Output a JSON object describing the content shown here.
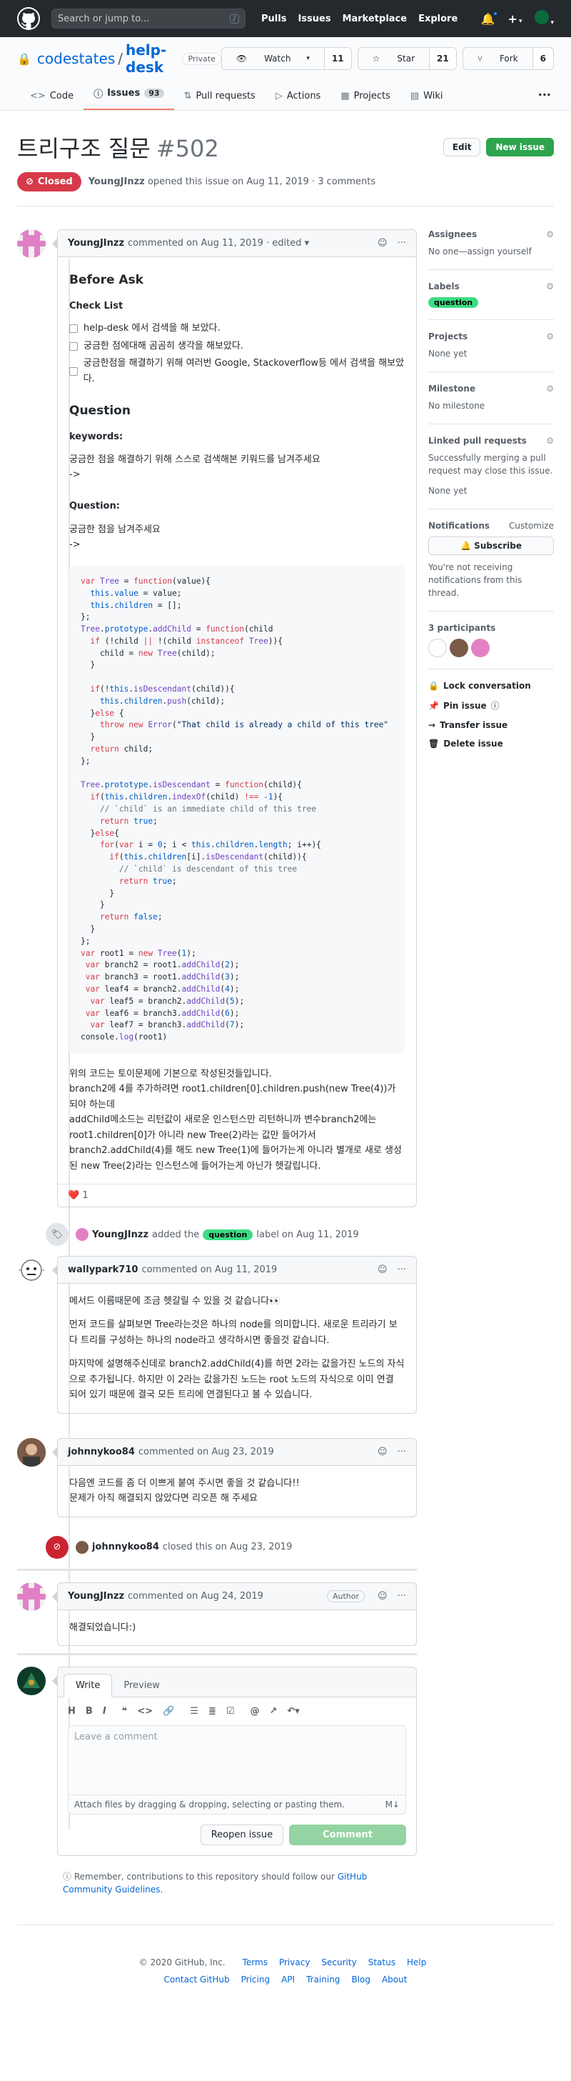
{
  "topbar": {
    "search_placeholder": "Search or jump to...",
    "slash": "/",
    "nav": [
      "Pulls",
      "Issues",
      "Marketplace",
      "Explore"
    ]
  },
  "repo": {
    "owner": "codestates",
    "sep": "/",
    "name": "help-desk",
    "visibility": "Private",
    "watch": "Watch",
    "watch_count": "11",
    "star": "Star",
    "star_count": "21",
    "fork": "Fork",
    "fork_count": "6"
  },
  "tabs": [
    {
      "label": "Code"
    },
    {
      "label": "Issues",
      "count": "93"
    },
    {
      "label": "Pull requests"
    },
    {
      "label": "Actions"
    },
    {
      "label": "Projects"
    },
    {
      "label": "Wiki"
    }
  ],
  "issue": {
    "title": "트리구조 질문",
    "number": "#502",
    "edit": "Edit",
    "new": "New issue",
    "status": "Closed",
    "author": "YoungJInzz",
    "meta": "opened this issue on Aug 11, 2019 · 3 comments"
  },
  "comment1": {
    "author": "YoungJInzz",
    "meta": "commented on Aug 11, 2019 · edited ▾",
    "h_before": "Before Ask",
    "h_check": "Check List",
    "checks": [
      "help-desk 에서 검색을 해 보았다.",
      "궁금한 점에대해 곰곰히 생각을 해보았다.",
      "궁금한점을 해결하기 위해 여러번 Google, Stackoverflow등 에서 검색을 해보았다."
    ],
    "h_question": "Question",
    "kw_label": "keywords:",
    "kw_text": "궁금한 점을 해결하기 위해 스스로 검색해본 키워드를 남겨주세요",
    "kw_arrow": "->",
    "q_label": "Question:",
    "q_text": "궁금한 점을 남겨주세요",
    "q_arrow": "->",
    "after1": "위의 코드는 토이문제에 기본으로 작성된것들입니다.",
    "after2": "branch2에 4를 추가하려면 root1.children[0].children.push(new Tree(4))가 되야 하는데",
    "after3": "addChild메소드는 리턴값이 새로운 인스턴스만 리턴하니까 변수branch2에는 root1.children[0]가 아니라 new Tree(2)라는 값만 들어가서 branch2.addChild(4)를 해도 new Tree(1)에 들어가는게 아니라 별개로 새로 생성된 new Tree(2)라는 인스턴스에 들어가는게 아닌가 헷갈립니다.",
    "reaction": "❤️",
    "reaction_count": "1"
  },
  "event1": {
    "author": "YoungJInzz",
    "pre": "added the",
    "label": "question",
    "post": "label on Aug 11, 2019"
  },
  "comment2": {
    "author": "wallypark710",
    "meta": "commented on Aug 11, 2019",
    "p1": "메서드 이름때문에 조금 헷갈릴 수 있을 것 같습니다👀",
    "p2": "먼저 코드를 살펴보면 Tree라는것은 하나의 node를 의미합니다. 새로운 트리라기 보다 트리를 구성하는 하나의 node라고 생각하시면 좋을것 같습니다.",
    "p3": "마지막에 설명해주신데로 branch2.addChild(4)를 하면 2라는 값을가진 노드의 자식으로 추가됩니다. 하지만 이 2라는 값을가진 노드는 root 노드의 자식으로 이미 연결 되어 있기 때문에 결국 모든 트리에 연결된다고 볼 수 있습니다."
  },
  "comment3": {
    "author": "johnnykoo84",
    "meta": "commented on Aug 23, 2019",
    "p1": "다음엔 코드를 좀 더 이쁘게 붙여 주시면 좋을 것 같습니다!!",
    "p2": "문제가 아직 해결되지 않았다면 리오픈 해 주세요"
  },
  "event2": {
    "author": "johnnykoo84",
    "text": "closed this on Aug 23, 2019"
  },
  "comment4": {
    "author": "YoungJInzz",
    "meta": "commented on Aug 24, 2019",
    "tag": "Author",
    "p1": "해결되었습니다:)"
  },
  "writer": {
    "write": "Write",
    "preview": "Preview",
    "placeholder": "Leave a comment",
    "attach": "Attach files by dragging & dropping, selecting or pasting them.",
    "md": "M↓",
    "reopen": "Reopen issue",
    "comment": "Comment"
  },
  "guide": {
    "pre": "Remember, contributions to this repository should follow our",
    "link": "GitHub Community Guidelines",
    "post": "."
  },
  "sidebar": {
    "assignees": "Assignees",
    "assignees_val": "No one—assign yourself",
    "labels": "Labels",
    "label_val": "question",
    "projects": "Projects",
    "projects_val": "None yet",
    "milestone": "Milestone",
    "milestone_val": "No milestone",
    "linked": "Linked pull requests",
    "linked_val": "Successfully merging a pull request may close this issue.",
    "linked_none": "None yet",
    "notif": "Notifications",
    "customize": "Customize",
    "subscribe": "Subscribe",
    "notif_text": "You're not receiving notifications from this thread.",
    "participants": "3 participants",
    "lock": "Lock conversation",
    "pin": "Pin issue",
    "transfer": "Transfer issue",
    "delete": "Delete issue"
  },
  "footer": {
    "copy": "© 2020 GitHub, Inc.",
    "row1": [
      "Terms",
      "Privacy",
      "Security",
      "Status",
      "Help"
    ],
    "row2": [
      "Contact GitHub",
      "Pricing",
      "API",
      "Training",
      "Blog",
      "About"
    ]
  },
  "colors": {
    "closed": "#d73a49",
    "green": "#2ea44f",
    "label": "#3ddc84"
  }
}
